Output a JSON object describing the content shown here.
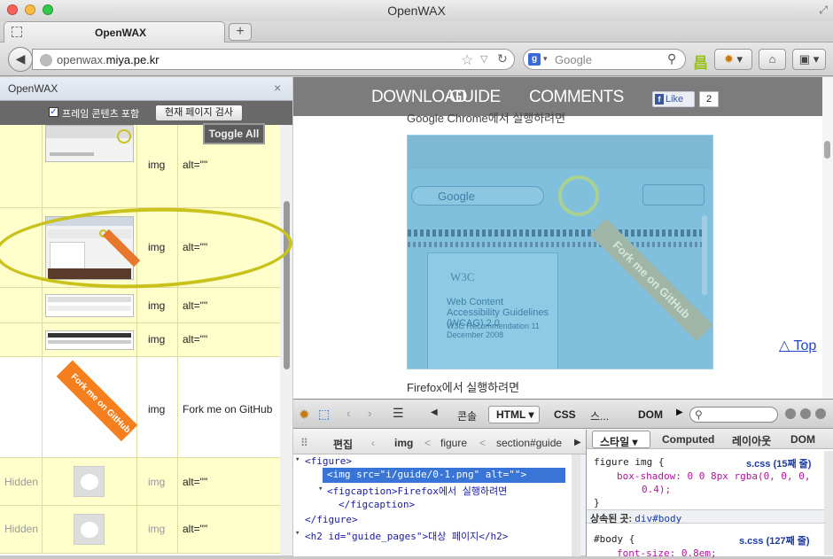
{
  "window": {
    "title": "OpenWAX"
  },
  "tab": {
    "label": "OpenWAX",
    "new_tab": "+"
  },
  "nav": {
    "url_prefix": "openwax.",
    "url_host": "miya.pe.kr",
    "search_placeholder": "Google"
  },
  "sidebar": {
    "title": "OpenWAX",
    "close": "×",
    "frame_checkbox_label": "프레임 콘텐츠 포함",
    "scan_button": "현재 페이지 검사",
    "toggle_all": "Toggle All",
    "rows": [
      {
        "status": "",
        "type": "img",
        "alt": "alt=\"\""
      },
      {
        "status": "",
        "type": "img",
        "alt": "alt=\"\""
      },
      {
        "status": "",
        "type": "img",
        "alt": "alt=\"\""
      },
      {
        "status": "",
        "type": "img",
        "alt": "alt=\"\""
      },
      {
        "status": "",
        "type": "img",
        "alt": "Fork me on GitHub"
      },
      {
        "status": "Hidden",
        "type": "img",
        "alt": "alt=\"\""
      },
      {
        "status": "Hidden",
        "type": "img",
        "alt": "alt=\"\""
      }
    ],
    "ribbon_text": "Fork me on GitHub"
  },
  "page": {
    "nav_items": [
      "DOWNLOAD",
      "GUIDE",
      "COMMENTS"
    ],
    "fb_like": "Like",
    "fb_count": "2",
    "chrome_caption": "Google Chrome에서 실행하려면",
    "firefox_caption": "Firefox에서 실행하려면",
    "top_link": "△ Top",
    "shot": {
      "search": "Google",
      "ribbon": "Fork me on GitHub",
      "w3c": "W3C",
      "doc_title": "Web Content Accessibility Guidelines (WCAG) 2.0",
      "doc_sub": "W3C Recommendation 11 December 2008"
    }
  },
  "devtools": {
    "tabs": {
      "console": "콘솔",
      "html": "HTML",
      "css": "CSS",
      "script": "스...",
      "dom": "DOM"
    },
    "crumb": {
      "edit": "편집",
      "c1": "img",
      "c2": "figure",
      "c3": "section#guide"
    },
    "code": [
      "<figure>",
      "<img src=\"i/guide/0-1.png\" alt=\"\">",
      "<figcaption>Firefox에서 실행하려면",
      "</figcaption>",
      "</figure>",
      "<h2 id=\"guide_pages\">대상 페이지</h2>"
    ],
    "side_tabs": {
      "style": "스타일",
      "computed": "Computed",
      "layout": "레이아웃",
      "dom": "DOM"
    },
    "rule1_selector": "figure img {",
    "rule1_source": "s.css (15째 줄)",
    "rule1_decl": "box-shadow: 0 0 8px rgba(0, 0, 0,",
    "rule1_decl2": "0.4);",
    "rule1_close": "}",
    "inherited_label": "상속된 곳:",
    "inherited_from": "div#body",
    "rule2_selector": "#body {",
    "rule2_source": "s.css (127째 줄)",
    "rule2_decl": "font-size: 0.8em;"
  },
  "colors": {
    "highlight": "#c9c21c",
    "row_bg": "#ffffcc",
    "selection": "#3875d7"
  }
}
